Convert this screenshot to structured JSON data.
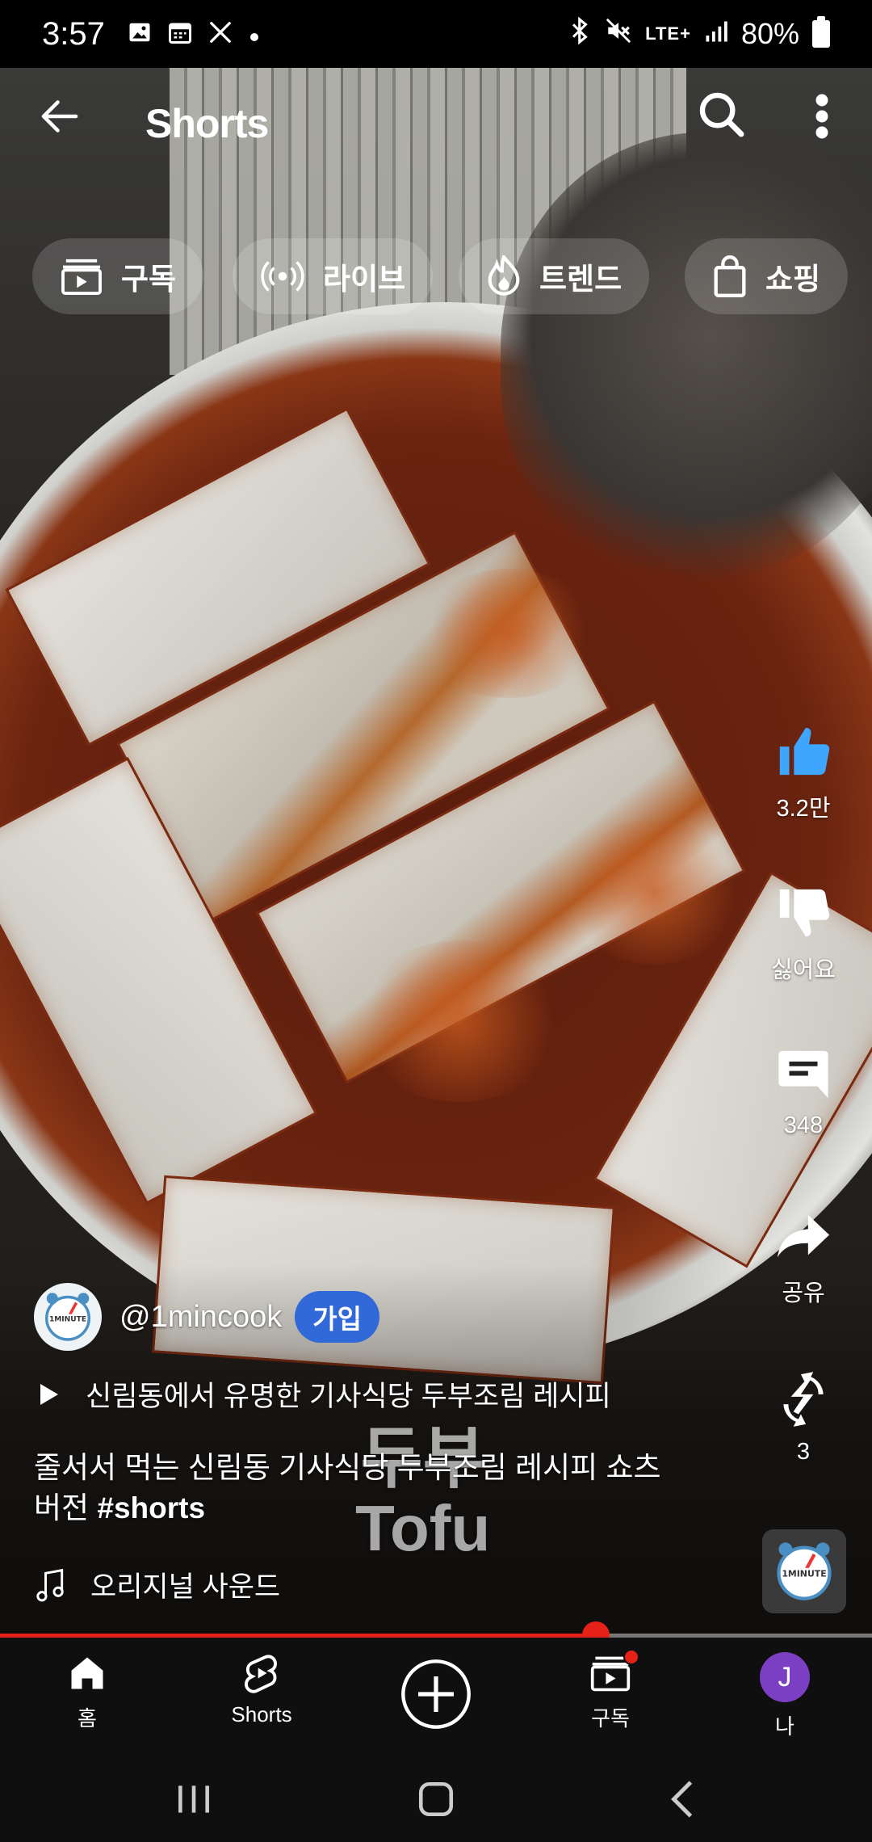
{
  "status_bar": {
    "time": "3:57",
    "left_icons": [
      "gallery-icon",
      "calendar-icon",
      "tools-icon",
      "dot-icon"
    ],
    "lte_label": "LTE+",
    "battery": "80%"
  },
  "header": {
    "title": "Shorts"
  },
  "chips": [
    {
      "label": "구독",
      "icon": "subscriptions-icon"
    },
    {
      "label": "라이브",
      "icon": "live-icon"
    },
    {
      "label": "트렌드",
      "icon": "trending-flame-icon"
    },
    {
      "label": "쇼핑",
      "icon": "shopping-bag-icon"
    }
  ],
  "actions": {
    "like_count": "3.2만",
    "dislike_label": "싫어요",
    "comment_count": "348",
    "share_label": "공유",
    "remix_count": "3"
  },
  "colors": {
    "like_accent": "#3ea6ff",
    "join_button": "#3169d8",
    "progress": "#e62117",
    "avatar_me": "#7b3fc4"
  },
  "video": {
    "overlay_text_ko": "두부",
    "overlay_text_en": "Tofu",
    "progress_fraction": 0.683
  },
  "channel": {
    "handle": "@1mincook",
    "join_label": "가입",
    "avatar_text": "1MINUTE"
  },
  "playlist": {
    "label": "신림동에서 유명한 기사식당 두부조림 레시피"
  },
  "caption": {
    "text": "줄서서 먹는 신림동 기사식당 두부조림 레시피 쇼츠버전",
    "hashtag": "#shorts"
  },
  "sound": {
    "label": "오리지널 사운드"
  },
  "bottom_nav": {
    "home": "홈",
    "shorts": "Shorts",
    "subscriptions": "구독",
    "me": "나",
    "me_initial": "J"
  }
}
